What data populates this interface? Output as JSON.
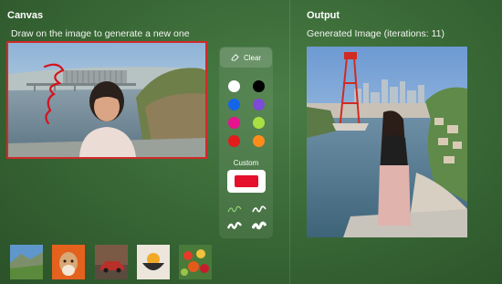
{
  "canvas_panel": {
    "title": "Canvas",
    "instruction": "Draw on the image to generate a new one"
  },
  "toolbar": {
    "clear_label": "Clear",
    "custom_label": "Custom",
    "colors": [
      "#ffffff",
      "#000000",
      "#1565e8",
      "#7d4bd6",
      "#e8128e",
      "#a8e042",
      "#e31b1b",
      "#ff8c18"
    ],
    "custom_color": "#e5102b",
    "brushes": [
      "brush-thin",
      "brush-medium",
      "brush-thick",
      "brush-bold"
    ]
  },
  "output_panel": {
    "title": "Output",
    "caption": "Generated Image (iterations: 11)"
  },
  "thumbnails": [
    "landscape-thumb",
    "dog-thumb",
    "car-thumb",
    "bowl-thumb",
    "food-thumb"
  ]
}
